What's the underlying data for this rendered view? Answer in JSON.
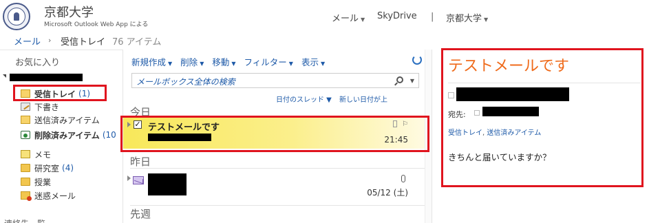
{
  "header": {
    "org_name": "京都大学",
    "app_name": "Microsoft Outlook Web App による",
    "nav": [
      "メール",
      "SkyDrive",
      "京都大学"
    ]
  },
  "breadcrumb": {
    "mail_link": "メール",
    "folder": "受信トレイ",
    "item_count": "76 アイテム"
  },
  "sidebar": {
    "favorites_label": "お気に入り",
    "folders": [
      {
        "label": "受信トレイ",
        "count": "(1)",
        "icon": "inbox-icon",
        "bold": true
      },
      {
        "label": "下書き",
        "count": "",
        "icon": "drafts-icon",
        "bold": false
      },
      {
        "label": "送信済みアイテム",
        "count": "",
        "icon": "sent-items-icon",
        "bold": false
      },
      {
        "label": "削除済みアイテム",
        "count": "(10",
        "icon": "deleted-items-icon",
        "bold": true
      },
      {
        "label": "メモ",
        "count": "",
        "icon": "notes-icon",
        "bold": false
      },
      {
        "label": "研究室",
        "count": "(4)",
        "icon": "folder-icon",
        "bold": false
      },
      {
        "label": "授業",
        "count": "",
        "icon": "folder-icon",
        "bold": false
      },
      {
        "label": "迷惑メール",
        "count": "",
        "icon": "junk-icon",
        "bold": false
      }
    ],
    "contacts_label": "連絡先一覧"
  },
  "toolbar": {
    "items": [
      "新規作成",
      "削除",
      "移動",
      "フィルター",
      "表示"
    ]
  },
  "search": {
    "placeholder": "メールボックス全体の検索"
  },
  "sort": {
    "thread": "日付のスレッド",
    "order": "新しい日付が上"
  },
  "groups": [
    "今日",
    "昨日",
    "先週"
  ],
  "messages": [
    {
      "subject": "テストメールです",
      "time": "21:45",
      "selected": true
    },
    {
      "subject": "",
      "time": "05/12 (土)",
      "selected": false
    }
  ],
  "reading_pane": {
    "subject": "テストメールです",
    "to_label": "宛先:",
    "folder_path_inbox": "受信トレイ",
    "folder_path_sep": ", ",
    "folder_path_sent": "送信済みアイテム",
    "body": "きちんと届いていますか？"
  },
  "colors": {
    "accent_blue": "#1e5aa8",
    "subject_orange": "#ef6a1a",
    "highlight_red": "#e0141e",
    "selected_yellow": "#f8e85a"
  }
}
